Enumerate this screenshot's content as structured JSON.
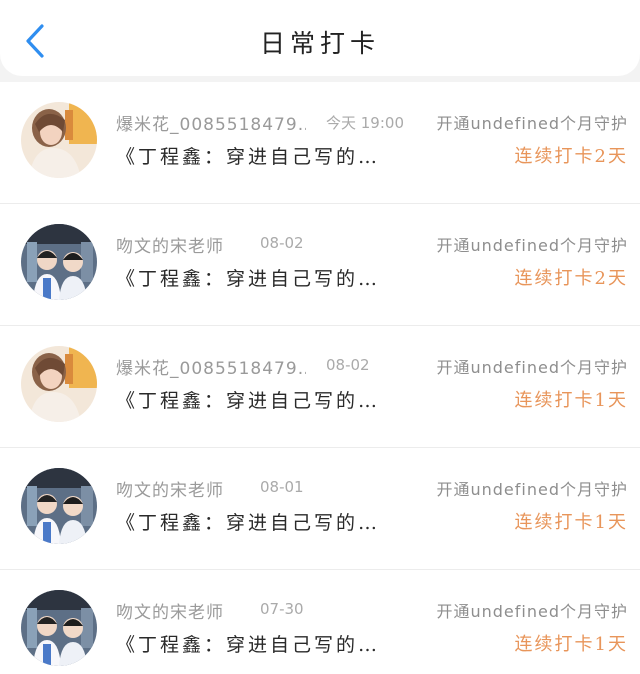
{
  "header": {
    "title": "日常打卡",
    "back_icon": "chevron-left-icon",
    "accent": "#2f8ef0"
  },
  "colors": {
    "streak": "#e8955a",
    "muted": "#9a9a9a"
  },
  "records": [
    {
      "avatar": "avatar-a",
      "name": "爆米花_0085518479…",
      "date": "今天 19:00",
      "protect": "开通undefined个月守护",
      "book": "《丁程鑫：穿进自己写的…",
      "streak": "连续打卡2天"
    },
    {
      "avatar": "avatar-b",
      "name": "吻文的宋老师",
      "date": "08-02",
      "protect": "开通undefined个月守护",
      "book": "《丁程鑫：穿进自己写的…",
      "streak": "连续打卡2天"
    },
    {
      "avatar": "avatar-a",
      "name": "爆米花_0085518479…",
      "date": "08-02",
      "protect": "开通undefined个月守护",
      "book": "《丁程鑫：穿进自己写的…",
      "streak": "连续打卡1天"
    },
    {
      "avatar": "avatar-b",
      "name": "吻文的宋老师",
      "date": "08-01",
      "protect": "开通undefined个月守护",
      "book": "《丁程鑫：穿进自己写的…",
      "streak": "连续打卡1天"
    },
    {
      "avatar": "avatar-b",
      "name": "吻文的宋老师",
      "date": "07-30",
      "protect": "开通undefined个月守护",
      "book": "《丁程鑫：穿进自己写的…",
      "streak": "连续打卡1天"
    }
  ]
}
